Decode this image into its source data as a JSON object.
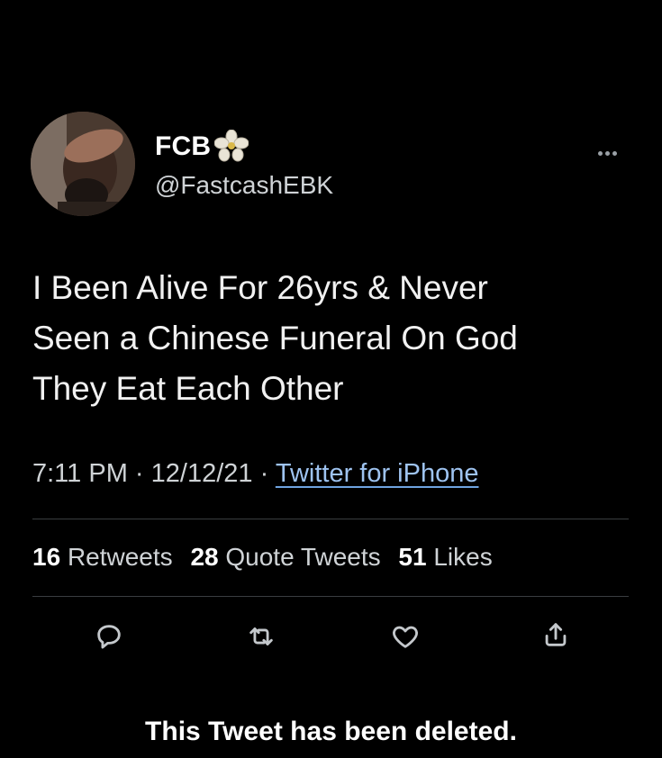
{
  "author": {
    "display_name": "FCB",
    "name_emoji": "white-flower-emoji",
    "handle": "@FastcashEBK"
  },
  "tweet": {
    "lines": [
      "I Been Alive For 26yrs & Never",
      "Seen a Chinese Funeral On God",
      "They Eat Each Other"
    ],
    "time": "7:11 PM",
    "date": "12/12/21",
    "source": "Twitter for iPhone",
    "separator": "·"
  },
  "stats": {
    "retweets_count": "16",
    "retweets_label": "Retweets",
    "quote_tweets_count": "28",
    "quote_tweets_label": "Quote Tweets",
    "likes_count": "51",
    "likes_label": "Likes"
  },
  "actions": {
    "icons": [
      "reply-icon",
      "retweet-icon",
      "like-icon",
      "share-icon"
    ]
  },
  "notice": "This Tweet has been deleted.",
  "colors": {
    "background": "#000000",
    "text": "#e7e9ea",
    "link": "#9ec3f0",
    "divider": "#3a3d40"
  }
}
